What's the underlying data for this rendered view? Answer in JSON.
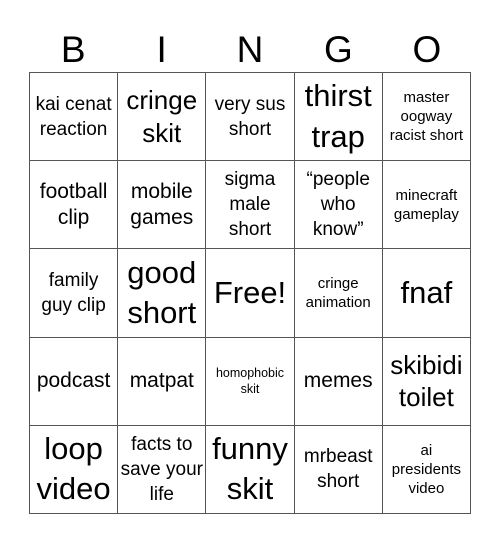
{
  "title_letters": [
    "B",
    "I",
    "N",
    "G",
    "O"
  ],
  "cells": [
    [
      {
        "text": "kai cenat reaction",
        "size": "n"
      },
      {
        "text": "cringe skit",
        "size": "l"
      },
      {
        "text": "very sus short",
        "size": "n"
      },
      {
        "text": "thirst trap",
        "size": "xl"
      },
      {
        "text": "master oogway racist short",
        "size": "s"
      }
    ],
    [
      {
        "text": "football clip",
        "size": "m"
      },
      {
        "text": "mobile games",
        "size": "m"
      },
      {
        "text": "sigma male short",
        "size": "n"
      },
      {
        "text": "“people who know”",
        "size": "n"
      },
      {
        "text": "minecraft gameplay",
        "size": "s"
      }
    ],
    [
      {
        "text": "family guy clip",
        "size": "n"
      },
      {
        "text": "good short",
        "size": "xl"
      },
      {
        "text": "Free!",
        "size": "xl"
      },
      {
        "text": "cringe animation",
        "size": "s"
      },
      {
        "text": "fnaf",
        "size": "xl"
      }
    ],
    [
      {
        "text": "podcast",
        "size": "m"
      },
      {
        "text": "matpat",
        "size": "m"
      },
      {
        "text": "homophobic skit",
        "size": "xs"
      },
      {
        "text": "memes",
        "size": "m"
      },
      {
        "text": "skibidi toilet",
        "size": "l"
      }
    ],
    [
      {
        "text": "loop video",
        "size": "xl"
      },
      {
        "text": "facts to save your life",
        "size": "n"
      },
      {
        "text": "funny skit",
        "size": "xl"
      },
      {
        "text": "mrbeast short",
        "size": "n"
      },
      {
        "text": "ai presidents video",
        "size": "s"
      }
    ]
  ],
  "colors": {
    "grid_line": "#555555",
    "text": "#000000",
    "background": "#ffffff"
  }
}
